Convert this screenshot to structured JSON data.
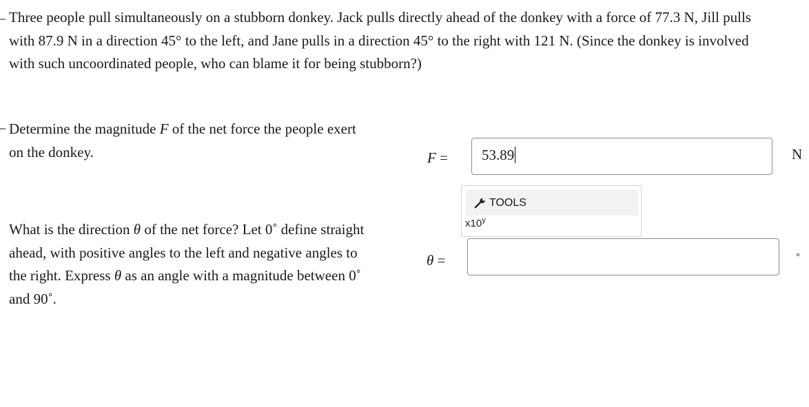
{
  "problem": {
    "text_line1": "Three people pull simultaneously on a stubborn donkey. Jack pulls directly ahead of the donkey with a force of 77.3 N, Jill pulls",
    "text_line2": "with 87.9 N in a direction 45° to the left, and Jane pulls in a direction 45° to the right with 121 N. (Since the donkey is involved",
    "text_line3": "with such uncoordinated people, who can blame it for being stubborn?)"
  },
  "q1": {
    "prompt_a": "Determine the magnitude ",
    "prompt_var": "F",
    "prompt_b": " of the net force the people exert",
    "prompt_line2": "on the donkey.",
    "label_var": "F",
    "label_eq": " =",
    "value": "53.89",
    "unit": "N"
  },
  "tools": {
    "label": "TOOLS",
    "icon": "wrench-icon",
    "sci_label": "x10",
    "sci_sup": "y"
  },
  "q2": {
    "line1_a": "What is the direction ",
    "line1_var": "θ",
    "line1_b": " of the net force? Let 0˚ define straight",
    "line2": "ahead, with positive angles to the left and negative angles to",
    "line3_a": "the right. Express ",
    "line3_var": "θ",
    "line3_b": " as an angle with a magnitude between 0˚",
    "line4": "and 90˚.",
    "label_var": "θ",
    "label_eq": " =",
    "value": "",
    "unit": "∘"
  }
}
